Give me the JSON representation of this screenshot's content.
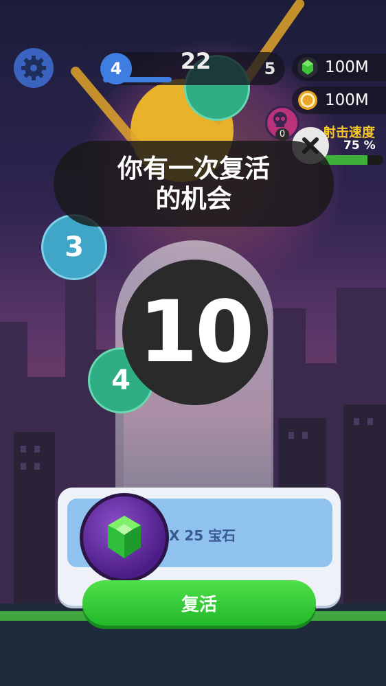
{
  "hud": {
    "level_current": "4",
    "level_next": "5",
    "score": "22",
    "gems": "100M",
    "coins": "100M",
    "skull_count": "0",
    "shoot_speed_label": "射击速度",
    "shoot_speed_value": "75 %",
    "shoot_speed_fraction": 0.75
  },
  "balls": [
    {
      "value": "3",
      "color": "#3fa6c8"
    },
    {
      "value": "4",
      "color": "#2fae86"
    }
  ],
  "dialog": {
    "message_line1": "你有一次复活",
    "message_line2": "的机会",
    "countdown": "10",
    "cost_text": "X 25 宝石",
    "revive_label": "复活"
  },
  "colors": {
    "accent_green": "#3fb03a",
    "level_blue": "#3f7de0",
    "gem_purple": "#6a2fb0"
  },
  "icons": [
    "gear-icon",
    "gem-icon",
    "coin-icon",
    "skull-icon",
    "close-icon",
    "emerald-icon"
  ]
}
